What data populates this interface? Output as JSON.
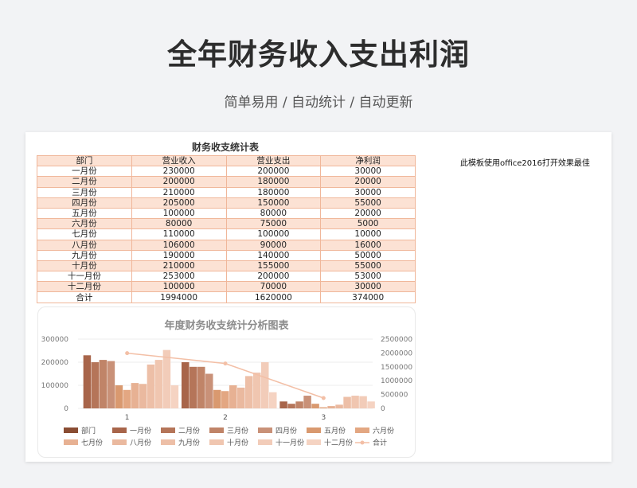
{
  "page": {
    "title": "全年财务收入支出利润",
    "subtitle": "简单易用 / 自动统计 / 自动更新"
  },
  "sheet": {
    "table_title": "财务收支统计表",
    "note": "此模板使用office2016打开效果最佳",
    "headers": [
      "部门",
      "营业收入",
      "营业支出",
      "净利润"
    ],
    "rows": [
      [
        "一月份",
        "230000",
        "200000",
        "30000"
      ],
      [
        "二月份",
        "200000",
        "180000",
        "20000"
      ],
      [
        "三月份",
        "210000",
        "180000",
        "30000"
      ],
      [
        "四月份",
        "205000",
        "150000",
        "55000"
      ],
      [
        "五月份",
        "100000",
        "80000",
        "20000"
      ],
      [
        "六月份",
        "80000",
        "75000",
        "5000"
      ],
      [
        "七月份",
        "110000",
        "100000",
        "10000"
      ],
      [
        "八月份",
        "106000",
        "90000",
        "16000"
      ],
      [
        "九月份",
        "190000",
        "140000",
        "50000"
      ],
      [
        "十月份",
        "210000",
        "155000",
        "55000"
      ],
      [
        "十一月份",
        "253000",
        "200000",
        "53000"
      ],
      [
        "十二月份",
        "100000",
        "70000",
        "30000"
      ]
    ],
    "total": [
      "合计",
      "1994000",
      "1620000",
      "374000"
    ]
  },
  "chart_data": {
    "type": "bar",
    "title": "年度财务收支统计分析图表",
    "categories": [
      "1",
      "2",
      "3"
    ],
    "y_left_ticks": [
      "300000",
      "200000",
      "100000",
      "0"
    ],
    "y_right_ticks": [
      "2500000",
      "2000000",
      "1500000",
      "1000000",
      "500000",
      "0"
    ],
    "ylim_left": [
      0,
      300000
    ],
    "ylim_right": [
      0,
      2500000
    ],
    "grid": true,
    "legend_position": "bottom",
    "series": [
      {
        "name": "部门",
        "values": [
          0,
          0,
          0
        ],
        "color": "#8a4d33"
      },
      {
        "name": "一月份",
        "values": [
          230000,
          200000,
          30000
        ],
        "color": "#a8654a"
      },
      {
        "name": "二月份",
        "values": [
          200000,
          180000,
          20000
        ],
        "color": "#b57559"
      },
      {
        "name": "三月份",
        "values": [
          210000,
          180000,
          30000
        ],
        "color": "#c08468"
      },
      {
        "name": "四月份",
        "values": [
          205000,
          150000,
          55000
        ],
        "color": "#c99178"
      },
      {
        "name": "五月份",
        "values": [
          100000,
          80000,
          20000
        ],
        "color": "#d9996f"
      },
      {
        "name": "六月份",
        "values": [
          80000,
          75000,
          5000
        ],
        "color": "#e3a782"
      },
      {
        "name": "七月份",
        "values": [
          110000,
          100000,
          10000
        ],
        "color": "#e7b193"
      },
      {
        "name": "八月份",
        "values": [
          106000,
          90000,
          16000
        ],
        "color": "#eab99f"
      },
      {
        "name": "九月份",
        "values": [
          190000,
          140000,
          50000
        ],
        "color": "#edbfa7"
      },
      {
        "name": "十月份",
        "values": [
          210000,
          155000,
          55000
        ],
        "color": "#f0c6b0"
      },
      {
        "name": "十一月份",
        "values": [
          253000,
          200000,
          53000
        ],
        "color": "#f2ccb9"
      },
      {
        "name": "十二月份",
        "values": [
          100000,
          70000,
          30000
        ],
        "color": "#f5d3c2"
      },
      {
        "name": "合计",
        "type": "line",
        "axis": "right",
        "values": [
          1994000,
          1620000,
          374000
        ],
        "color": "#f3bfa6"
      }
    ]
  }
}
